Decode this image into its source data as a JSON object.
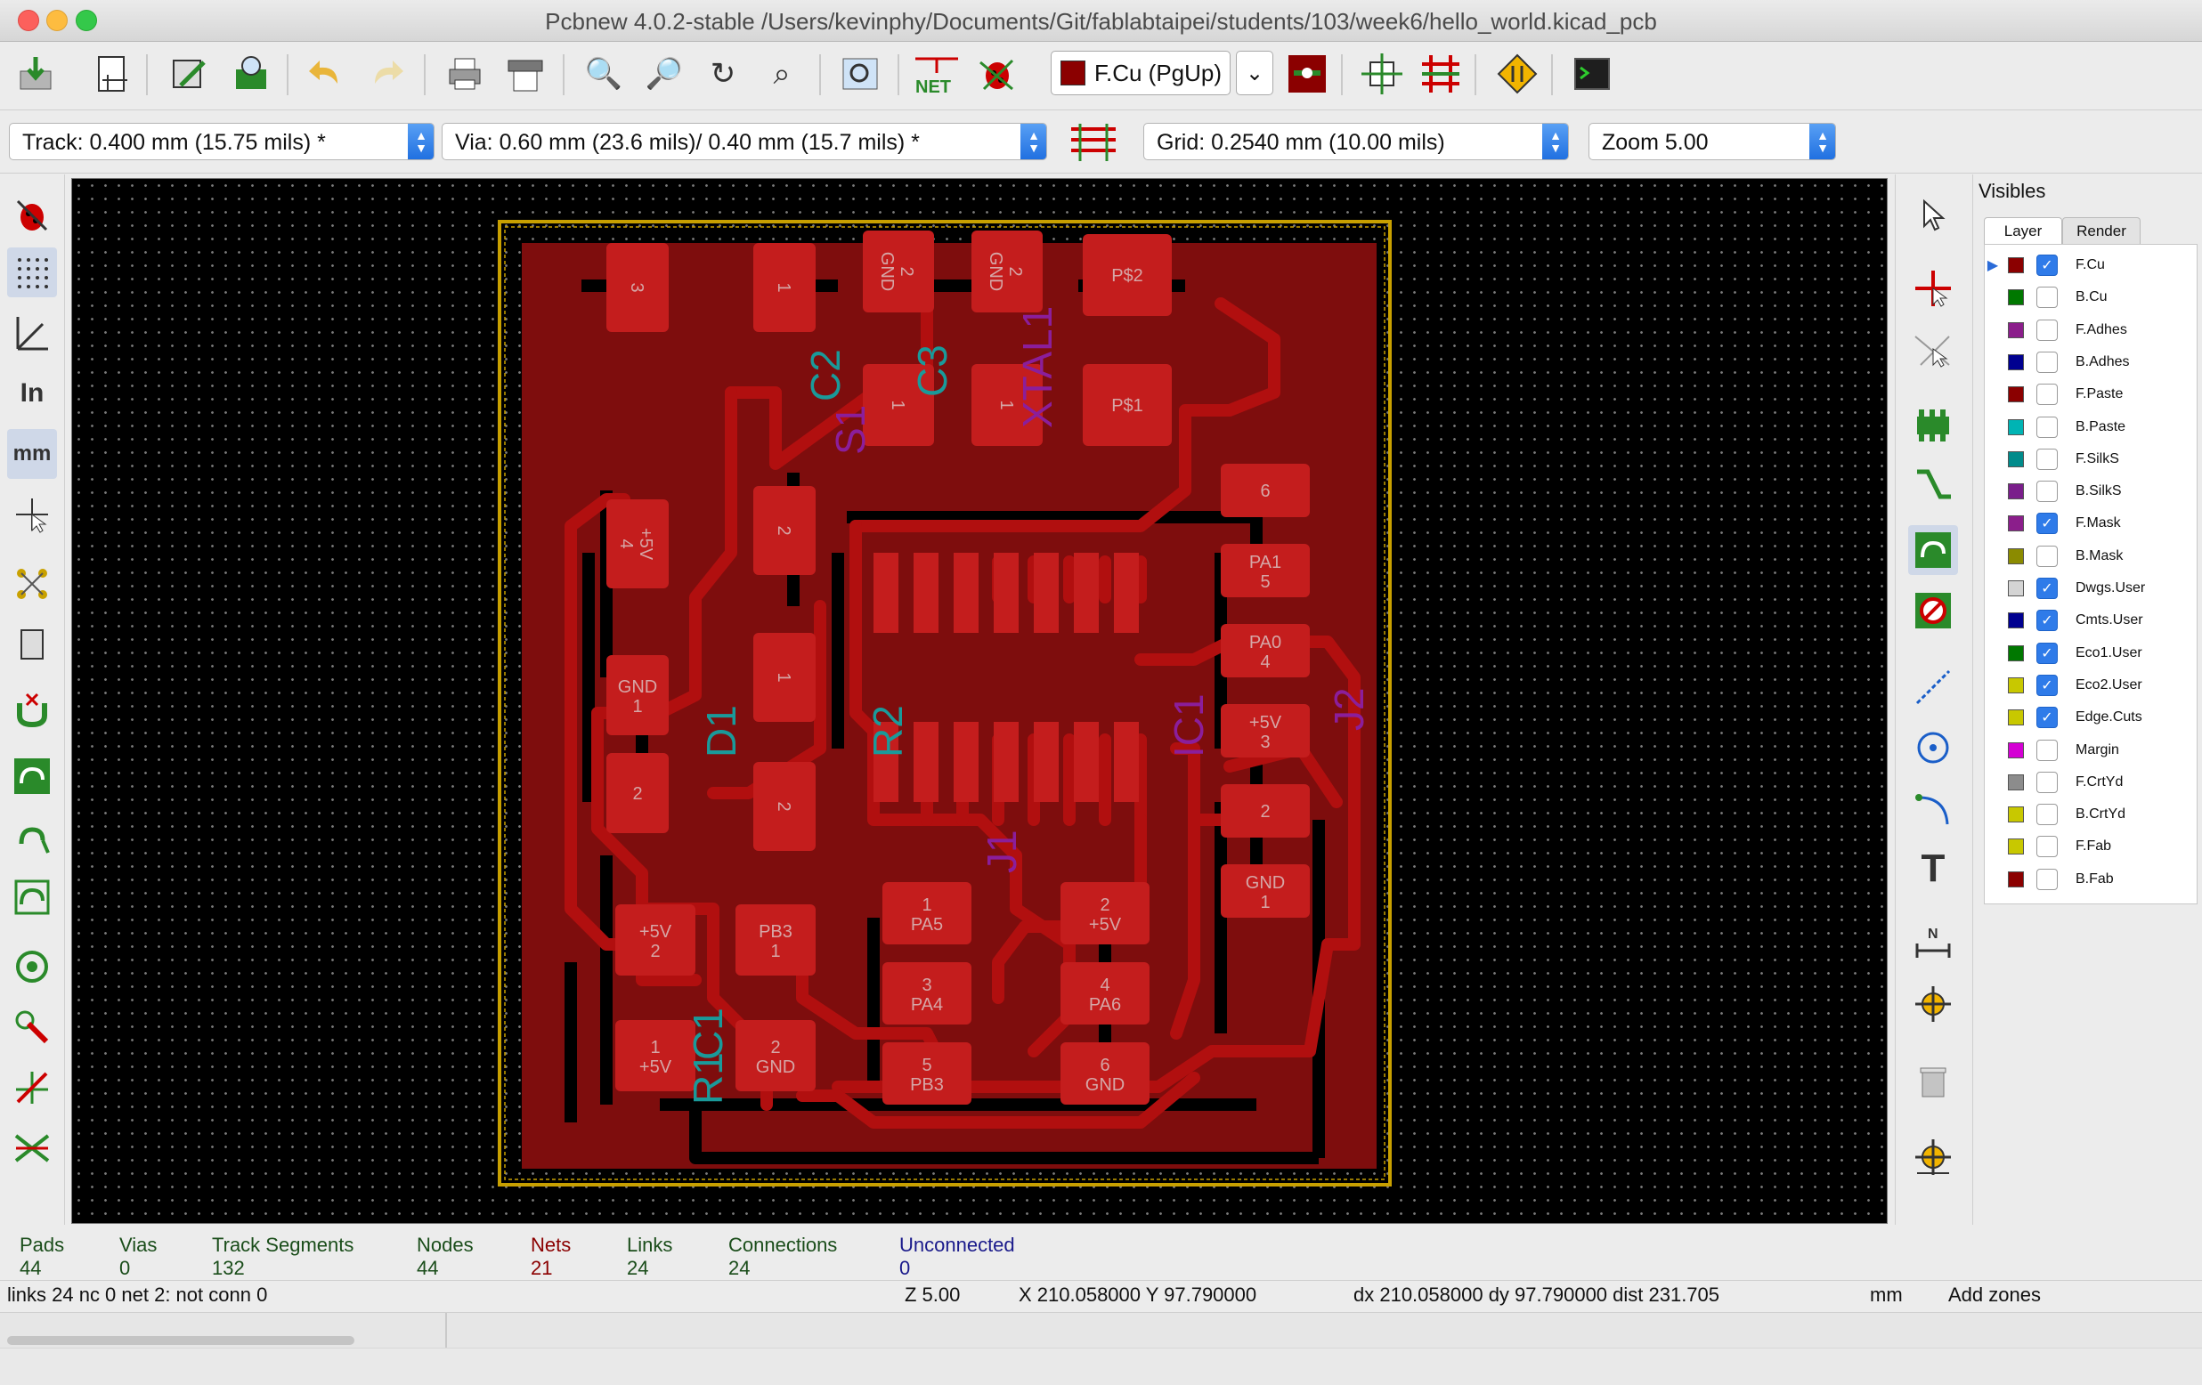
{
  "window": {
    "title": "Pcbnew 4.0.2-stable /Users/kevinphy/Documents/Git/fablabtaipei/students/103/week6/hello_world.kicad_pcb"
  },
  "toolbar": {
    "active_layer": "F.Cu (PgUp)",
    "icons": [
      "save-icon",
      "page-settings-icon",
      "footprint-editor-icon",
      "footprint-viewer-icon",
      "undo-icon",
      "redo-icon",
      "print-icon",
      "plot-icon",
      "zoom-in-icon",
      "zoom-out-icon",
      "redraw-icon",
      "zoom-fit-icon",
      "find-icon",
      "netlist-icon",
      "drc-icon",
      "layer-pair-icon",
      "auto-place-icon",
      "auto-route-icon",
      "microwave-icon",
      "scripting-console-icon"
    ]
  },
  "options": {
    "track": "Track: 0.400 mm (15.75 mils) *",
    "via": "Via: 0.60 mm (23.6 mils)/ 0.40 mm (15.7 mils) *",
    "grid": "Grid: 0.2540 mm (10.00 mils)",
    "zoom": "Zoom 5.00"
  },
  "visibles": {
    "title": "Visibles",
    "tabs": [
      "Layer",
      "Render"
    ],
    "active_tab": "Layer",
    "layers": [
      {
        "name": "F.Cu",
        "color": "#8b0000",
        "checked": true,
        "active": true
      },
      {
        "name": "B.Cu",
        "color": "#007800",
        "checked": false
      },
      {
        "name": "F.Adhes",
        "color": "#8b1e8b",
        "checked": false
      },
      {
        "name": "B.Adhes",
        "color": "#000090",
        "checked": false
      },
      {
        "name": "F.Paste",
        "color": "#8b0000",
        "checked": false
      },
      {
        "name": "B.Paste",
        "color": "#00b4b4",
        "checked": false
      },
      {
        "name": "F.SilkS",
        "color": "#008b8b",
        "checked": false
      },
      {
        "name": "B.SilkS",
        "color": "#7a1e8b",
        "checked": false
      },
      {
        "name": "F.Mask",
        "color": "#8b1e8b",
        "checked": true
      },
      {
        "name": "B.Mask",
        "color": "#8b8b00",
        "checked": false
      },
      {
        "name": "Dwgs.User",
        "color": "#d4d4d4",
        "checked": true
      },
      {
        "name": "Cmts.User",
        "color": "#000090",
        "checked": true
      },
      {
        "name": "Eco1.User",
        "color": "#007800",
        "checked": true
      },
      {
        "name": "Eco2.User",
        "color": "#c8c800",
        "checked": true
      },
      {
        "name": "Edge.Cuts",
        "color": "#c8c800",
        "checked": true
      },
      {
        "name": "Margin",
        "color": "#d400d4",
        "checked": false
      },
      {
        "name": "F.CrtYd",
        "color": "#8c8c8c",
        "checked": false
      },
      {
        "name": "B.CrtYd",
        "color": "#c8c800",
        "checked": false
      },
      {
        "name": "F.Fab",
        "color": "#c8c800",
        "checked": false
      },
      {
        "name": "B.Fab",
        "color": "#8b0000",
        "checked": false
      }
    ]
  },
  "status": [
    {
      "label": "Pads",
      "value": "44",
      "color": "#1a4d1a"
    },
    {
      "label": "Vias",
      "value": "0",
      "color": "#1a4d1a"
    },
    {
      "label": "Track Segments",
      "value": "132",
      "color": "#1a4d1a"
    },
    {
      "label": "Nodes",
      "value": "44",
      "color": "#1a4d1a"
    },
    {
      "label": "Nets",
      "value": "21",
      "color": "#8b0000"
    },
    {
      "label": "Links",
      "value": "24",
      "color": "#1a4d1a"
    },
    {
      "label": "Connections",
      "value": "24",
      "color": "#1a4d1a"
    },
    {
      "label": "Unconnected",
      "value": "0",
      "color": "#1a1a8b"
    }
  ],
  "infobar": {
    "message": "links 24 nc 0  net 2: not conn 0",
    "zoom": "Z 5.00",
    "xy": "X 210.058000  Y 97.790000",
    "dxy": "dx 210.058000  dy 97.790000  dist 231.705",
    "units": "mm",
    "mode": "Add zones"
  },
  "pcb": {
    "pads": [
      "3",
      "1",
      "2\nGND",
      "2\nGND",
      "P$2",
      "P$1",
      "1",
      "1",
      "+5V\n4",
      "2",
      "1",
      "GND\n1",
      "2",
      "2",
      "+5V\n2",
      "PB3\n1",
      "1\n+5V",
      "2\nGND",
      "1\nPA5",
      "3\nPA4",
      "5\nPB3",
      "2\n+5V",
      "4\nPA6",
      "6\nGND",
      "6",
      "PA1\n5",
      "PA0\n4",
      "+5V\n3",
      "2",
      "GND\n1"
    ],
    "references": [
      "C2",
      "C3",
      "XTAL1",
      "S1",
      "D1",
      "R2",
      "IC1",
      "J2",
      "J1",
      "C1",
      "R1"
    ]
  }
}
